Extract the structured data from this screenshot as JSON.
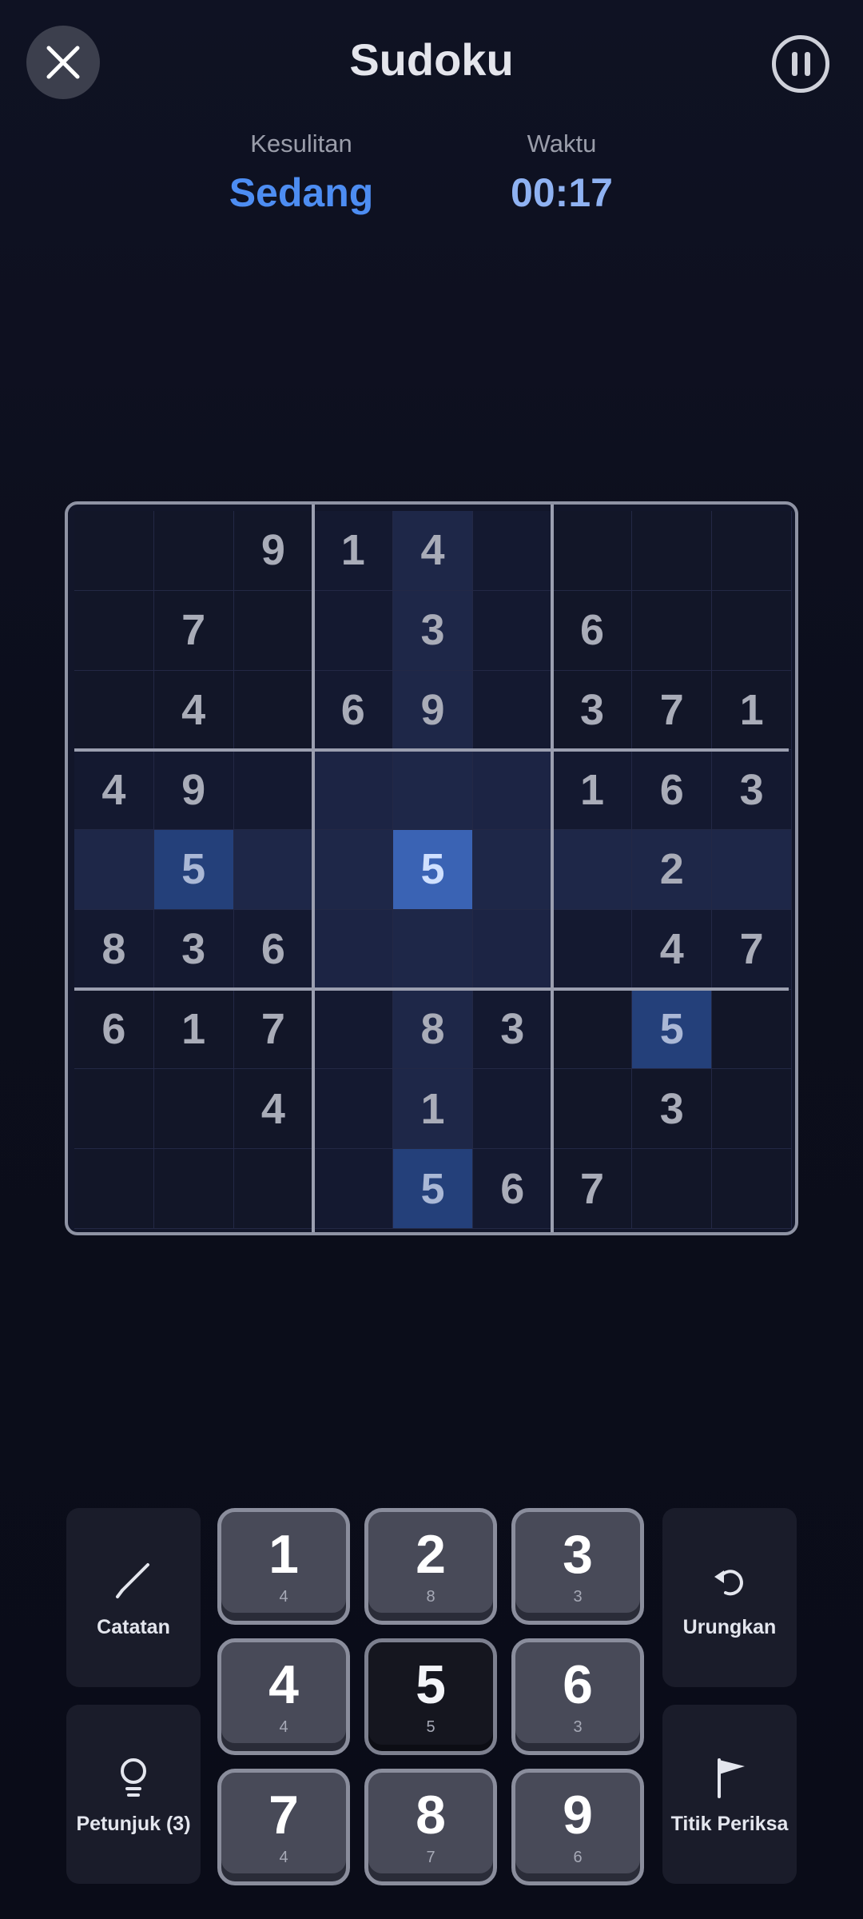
{
  "header": {
    "title": "Sudoku"
  },
  "stats": {
    "difficulty_label": "Kesulitan",
    "difficulty_value": "Sedang",
    "time_label": "Waktu",
    "time_value": "00:17"
  },
  "board": {
    "selected": {
      "row": 4,
      "col": 4
    },
    "highlight_value": "5",
    "rows": [
      [
        "",
        "",
        "9",
        "1",
        "4",
        "",
        "",
        "",
        ""
      ],
      [
        "",
        "7",
        "",
        "",
        "3",
        "",
        "6",
        "",
        ""
      ],
      [
        "",
        "4",
        "",
        "6",
        "9",
        "",
        "3",
        "7",
        "1"
      ],
      [
        "4",
        "9",
        "",
        "",
        "",
        "",
        "1",
        "6",
        "3"
      ],
      [
        "",
        "5",
        "",
        "",
        "5",
        "",
        "",
        "2",
        ""
      ],
      [
        "8",
        "3",
        "6",
        "",
        "",
        "",
        "",
        "4",
        "7"
      ],
      [
        "6",
        "1",
        "7",
        "",
        "8",
        "3",
        "",
        "5",
        ""
      ],
      [
        "",
        "",
        "4",
        "",
        "1",
        "",
        "",
        "3",
        ""
      ],
      [
        "",
        "",
        "",
        "",
        "5",
        "6",
        "7",
        "",
        ""
      ]
    ]
  },
  "controls": {
    "notes_label": "Catatan",
    "hint_label": "Petunjuk (3)",
    "undo_label": "Urungkan",
    "checkpoint_label": "Titik Periksa",
    "numbers": [
      {
        "value": "1",
        "count": "4",
        "disabled": false
      },
      {
        "value": "2",
        "count": "8",
        "disabled": false
      },
      {
        "value": "3",
        "count": "3",
        "disabled": false
      },
      {
        "value": "4",
        "count": "4",
        "disabled": false
      },
      {
        "value": "5",
        "count": "5",
        "disabled": true
      },
      {
        "value": "6",
        "count": "3",
        "disabled": false
      },
      {
        "value": "7",
        "count": "4",
        "disabled": false
      },
      {
        "value": "8",
        "count": "7",
        "disabled": false
      },
      {
        "value": "9",
        "count": "6",
        "disabled": false
      }
    ]
  },
  "colors": {
    "accent": "#4d8df2",
    "selected_cell": "#3a63b4",
    "same_number_cell": "#24407a"
  },
  "icons": [
    "close-icon",
    "pause-icon",
    "pencil-icon",
    "lightbulb-icon",
    "undo-icon",
    "flag-icon"
  ]
}
